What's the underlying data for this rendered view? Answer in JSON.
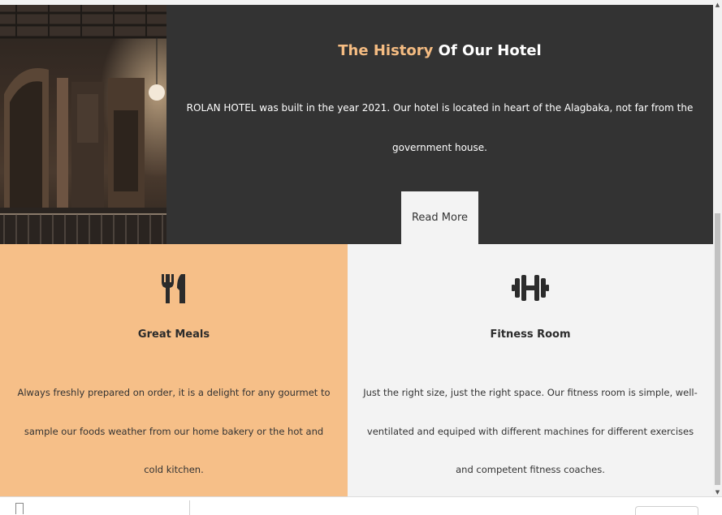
{
  "history": {
    "title_accent": "The History",
    "title_rest": " Of Our Hotel",
    "body": "ROLAN HOTEL was built in the year 2021. Our hotel is located in heart of the Alagbaka, not far from the government house.",
    "read_more": "Read More"
  },
  "features": [
    {
      "icon": "utensils-icon",
      "title": "Great Meals",
      "text": "Always freshly prepared on order, it is a delight for any gourmet to sample our foods weather from our home bakery or the hot and cold kitchen."
    },
    {
      "icon": "dumbbell-icon",
      "title": "Fitness Room",
      "text": "Just the right size, just the right space. Our fitness room is simple, well-ventilated and equiped with different machines for different exercises and competent fitness coaches."
    }
  ],
  "colors": {
    "accent": "#f5bc82",
    "dark_panel": "#333333",
    "meals_bg": "#f6bf88",
    "fitness_bg": "#f3f3f3"
  }
}
